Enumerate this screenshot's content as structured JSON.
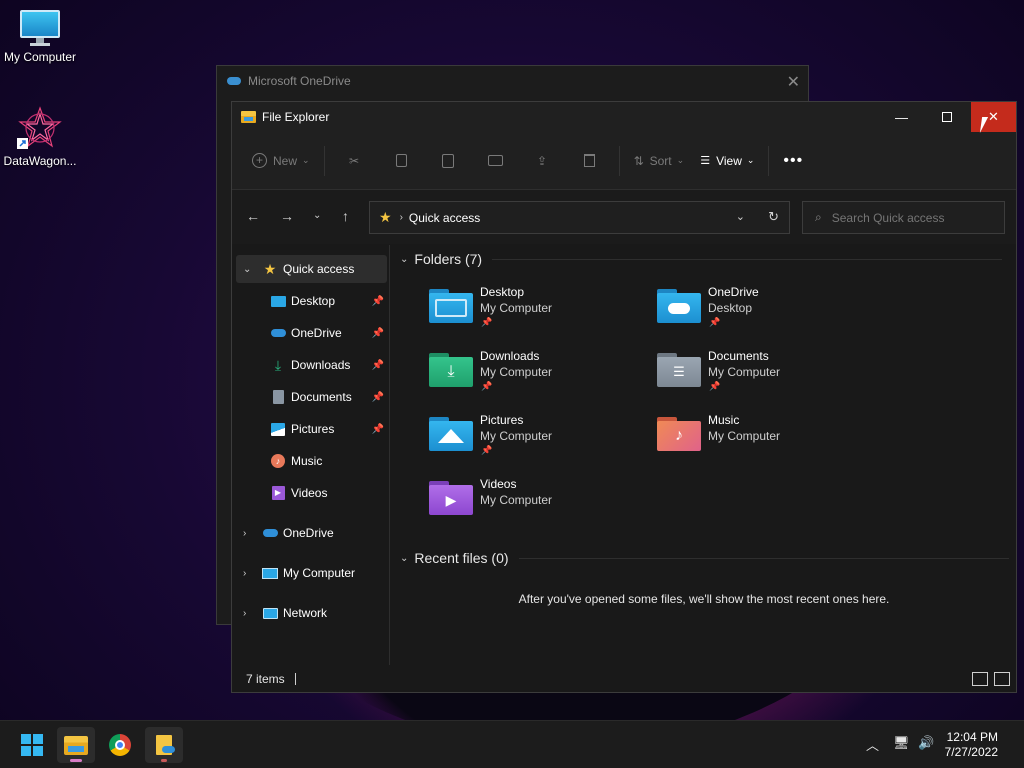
{
  "desktop": {
    "icons": [
      {
        "label": "My Computer"
      },
      {
        "label": "DataWagon..."
      }
    ]
  },
  "background_window": {
    "title": "Microsoft OneDrive"
  },
  "explorer": {
    "title": "File Explorer",
    "toolbar": {
      "new_label": "New",
      "sort_label": "Sort",
      "view_label": "View"
    },
    "address": {
      "location": "Quick access",
      "search_placeholder": "Search Quick access"
    },
    "nav": {
      "quick_access": "Quick access",
      "pinned": [
        {
          "label": "Desktop",
          "pinned": true
        },
        {
          "label": "OneDrive",
          "pinned": true
        },
        {
          "label": "Downloads",
          "pinned": true
        },
        {
          "label": "Documents",
          "pinned": true
        },
        {
          "label": "Pictures",
          "pinned": true
        },
        {
          "label": "Music",
          "pinned": false
        },
        {
          "label": "Videos",
          "pinned": false
        }
      ],
      "roots": [
        {
          "label": "OneDrive"
        },
        {
          "label": "My Computer"
        },
        {
          "label": "Network"
        }
      ]
    },
    "content": {
      "folders_header": "Folders (7)",
      "folders": [
        {
          "name": "Desktop",
          "location": "My Computer",
          "pinned": true,
          "color": "#2aa7e6"
        },
        {
          "name": "OneDrive",
          "location": "Desktop",
          "pinned": true,
          "color": "#2aa7e6"
        },
        {
          "name": "Downloads",
          "location": "My Computer",
          "pinned": true,
          "color": "#27b37e"
        },
        {
          "name": "Documents",
          "location": "My Computer",
          "pinned": true,
          "color": "#8a96a3"
        },
        {
          "name": "Pictures",
          "location": "My Computer",
          "pinned": true,
          "color": "#2aa7e6"
        },
        {
          "name": "Music",
          "location": "My Computer",
          "pinned": false,
          "color": "#e8795a"
        },
        {
          "name": "Videos",
          "location": "My Computer",
          "pinned": false,
          "color": "#9b59d8"
        }
      ],
      "recent_header": "Recent files (0)",
      "recent_empty": "After you've opened some files, we'll show the most recent ones here."
    },
    "status": {
      "item_count": "7 items"
    }
  },
  "taskbar": {
    "time": "12:04 PM",
    "date": "7/27/2022"
  }
}
